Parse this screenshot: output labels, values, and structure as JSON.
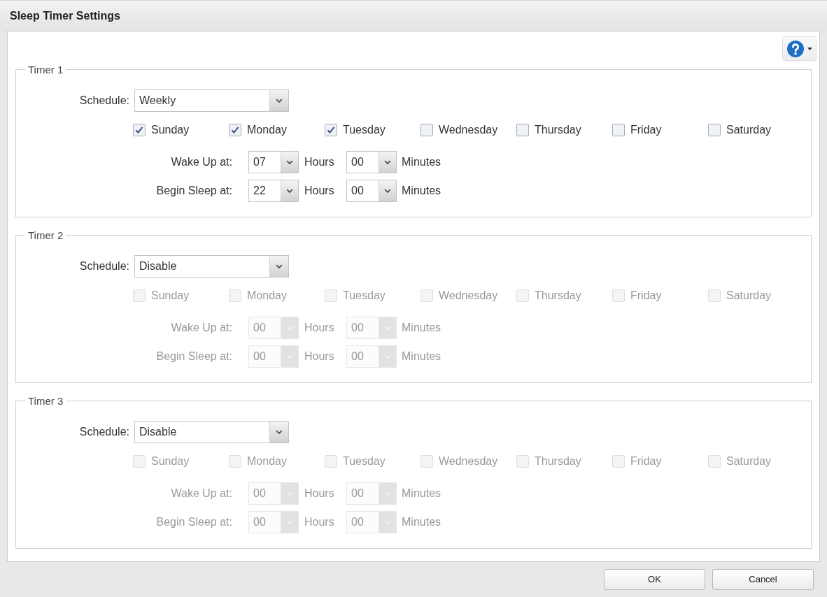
{
  "window": {
    "title": "Sleep Timer Settings"
  },
  "timers": [
    {
      "legend": "Timer 1",
      "schedule": {
        "label": "Schedule:",
        "value": "Weekly"
      },
      "days": [
        {
          "label": "Sunday",
          "checked": true,
          "disabled": false
        },
        {
          "label": "Monday",
          "checked": true,
          "disabled": false
        },
        {
          "label": "Tuesday",
          "checked": true,
          "disabled": false
        },
        {
          "label": "Wednesday",
          "checked": false,
          "disabled": false
        },
        {
          "label": "Thursday",
          "checked": false,
          "disabled": false
        },
        {
          "label": "Friday",
          "checked": false,
          "disabled": false
        },
        {
          "label": "Saturday",
          "checked": false,
          "disabled": false
        }
      ],
      "times": [
        {
          "label": "Wake Up at:",
          "hour": "07",
          "hours_unit": "Hours",
          "minute": "00",
          "minutes_unit": "Minutes",
          "disabled": false
        },
        {
          "label": "Begin Sleep at:",
          "hour": "22",
          "hours_unit": "Hours",
          "minute": "00",
          "minutes_unit": "Minutes",
          "disabled": false
        }
      ]
    },
    {
      "legend": "Timer 2",
      "schedule": {
        "label": "Schedule:",
        "value": "Disable"
      },
      "days": [
        {
          "label": "Sunday",
          "checked": false,
          "disabled": true
        },
        {
          "label": "Monday",
          "checked": false,
          "disabled": true
        },
        {
          "label": "Tuesday",
          "checked": false,
          "disabled": true
        },
        {
          "label": "Wednesday",
          "checked": false,
          "disabled": true
        },
        {
          "label": "Thursday",
          "checked": false,
          "disabled": true
        },
        {
          "label": "Friday",
          "checked": false,
          "disabled": true
        },
        {
          "label": "Saturday",
          "checked": false,
          "disabled": true
        }
      ],
      "times": [
        {
          "label": "Wake Up at:",
          "hour": "00",
          "hours_unit": "Hours",
          "minute": "00",
          "minutes_unit": "Minutes",
          "disabled": true
        },
        {
          "label": "Begin Sleep at:",
          "hour": "00",
          "hours_unit": "Hours",
          "minute": "00",
          "minutes_unit": "Minutes",
          "disabled": true
        }
      ]
    },
    {
      "legend": "Timer 3",
      "schedule": {
        "label": "Schedule:",
        "value": "Disable"
      },
      "days": [
        {
          "label": "Sunday",
          "checked": false,
          "disabled": true
        },
        {
          "label": "Monday",
          "checked": false,
          "disabled": true
        },
        {
          "label": "Tuesday",
          "checked": false,
          "disabled": true
        },
        {
          "label": "Wednesday",
          "checked": false,
          "disabled": true
        },
        {
          "label": "Thursday",
          "checked": false,
          "disabled": true
        },
        {
          "label": "Friday",
          "checked": false,
          "disabled": true
        },
        {
          "label": "Saturday",
          "checked": false,
          "disabled": true
        }
      ],
      "times": [
        {
          "label": "Wake Up at:",
          "hour": "00",
          "hours_unit": "Hours",
          "minute": "00",
          "minutes_unit": "Minutes",
          "disabled": true
        },
        {
          "label": "Begin Sleep at:",
          "hour": "00",
          "hours_unit": "Hours",
          "minute": "00",
          "minutes_unit": "Minutes",
          "disabled": true
        }
      ]
    }
  ],
  "buttons": [
    {
      "label": "OK"
    },
    {
      "label": "Cancel"
    }
  ]
}
